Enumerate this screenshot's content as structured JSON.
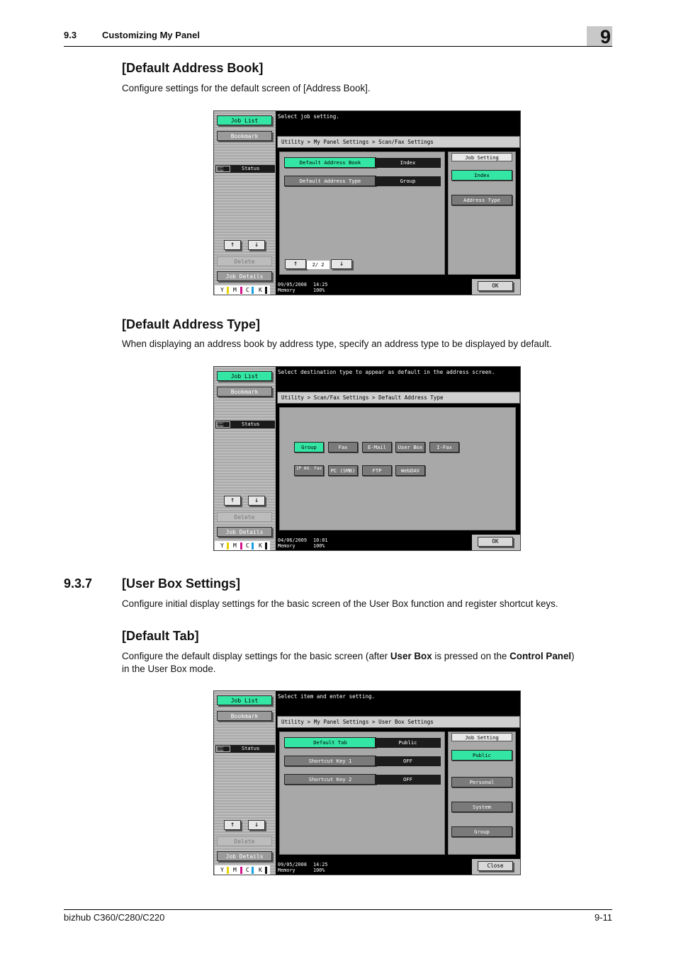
{
  "header": {
    "section_number": "9.3",
    "section_title": "Customizing My Panel",
    "chapter": "9"
  },
  "sections": {
    "default_address_book": {
      "title": "[Default Address Book]",
      "text": "Configure settings for the default screen of [Address Book]."
    },
    "default_address_type": {
      "title": "[Default Address Type]",
      "text": "When displaying an address book by address type, specify an address type to be displayed by default."
    },
    "user_box_settings": {
      "number": "9.3.7",
      "title": "[User Box Settings]",
      "text": "Configure initial display settings for the basic screen of the User Box function and register shortcut keys."
    },
    "default_tab": {
      "title": "[Default Tab]",
      "text_1": "Configure the default display settings for the basic screen (after ",
      "bold_1": "User Box",
      "text_2": " is pressed on the ",
      "bold_2": "Control Panel",
      "text_3": ")",
      "text_4": "in the User Box mode."
    }
  },
  "common_panel": {
    "job_list": "Job List",
    "bookmark": "Bookmark",
    "user_name_icon": "User Name",
    "status": "Status",
    "delete": "Delete",
    "job_details": "Job Details",
    "up_arrow": "↑",
    "down_arrow": "↓",
    "toner": {
      "y": "Y",
      "m": "M",
      "c": "C",
      "k": "K"
    },
    "toner_colors": {
      "y": "#e6d200",
      "m": "#d4148c",
      "c": "#18a0e0",
      "k": "#111111"
    },
    "accent_green": "#34e6a4"
  },
  "screen1": {
    "message": "Select job setting.",
    "breadcrumb": "Utility > My Panel Settings > Scan/Fax Settings",
    "rows": [
      {
        "label": "Default Address Book",
        "value": "Index"
      },
      {
        "label": "Default Address Type",
        "value": "Group"
      }
    ],
    "right_title": "Job Setting",
    "right_options": [
      "Index",
      "Address Type"
    ],
    "page": "2/ 2",
    "date": "09/05/2008",
    "time": "14:25",
    "memory": "Memory",
    "memory_value": "100%",
    "ok": "OK"
  },
  "screen2": {
    "message": "Select destination type to appear as default in the address screen.",
    "breadcrumb": "Utility > Scan/Fax Settings > Default Address Type",
    "types_row1": [
      "Group",
      "Fax",
      "E-Mail",
      "User Box",
      "I-Fax"
    ],
    "types_row2": [
      "IP Ad. Fax",
      "PC (SMB)",
      "FTP",
      "WebDAV"
    ],
    "date": "04/06/2009",
    "time": "10:01",
    "memory": "Memory",
    "memory_value": "100%",
    "ok": "OK"
  },
  "screen3": {
    "message": "Select item and enter setting.",
    "breadcrumb": "Utility > My Panel Settings > User Box Settings",
    "rows": [
      {
        "label": "Default Tab",
        "value": "Public"
      },
      {
        "label": "Shortcut Key 1",
        "value": "OFF"
      },
      {
        "label": "Shortcut Key 2",
        "value": "OFF"
      }
    ],
    "right_title": "Job Setting",
    "right_options": [
      "Public",
      "Personal",
      "System",
      "Group"
    ],
    "date": "09/05/2008",
    "time": "14:25",
    "memory": "Memory",
    "memory_value": "100%",
    "close": "Close"
  },
  "footer": {
    "product": "bizhub C360/C280/C220",
    "page": "9-11"
  }
}
